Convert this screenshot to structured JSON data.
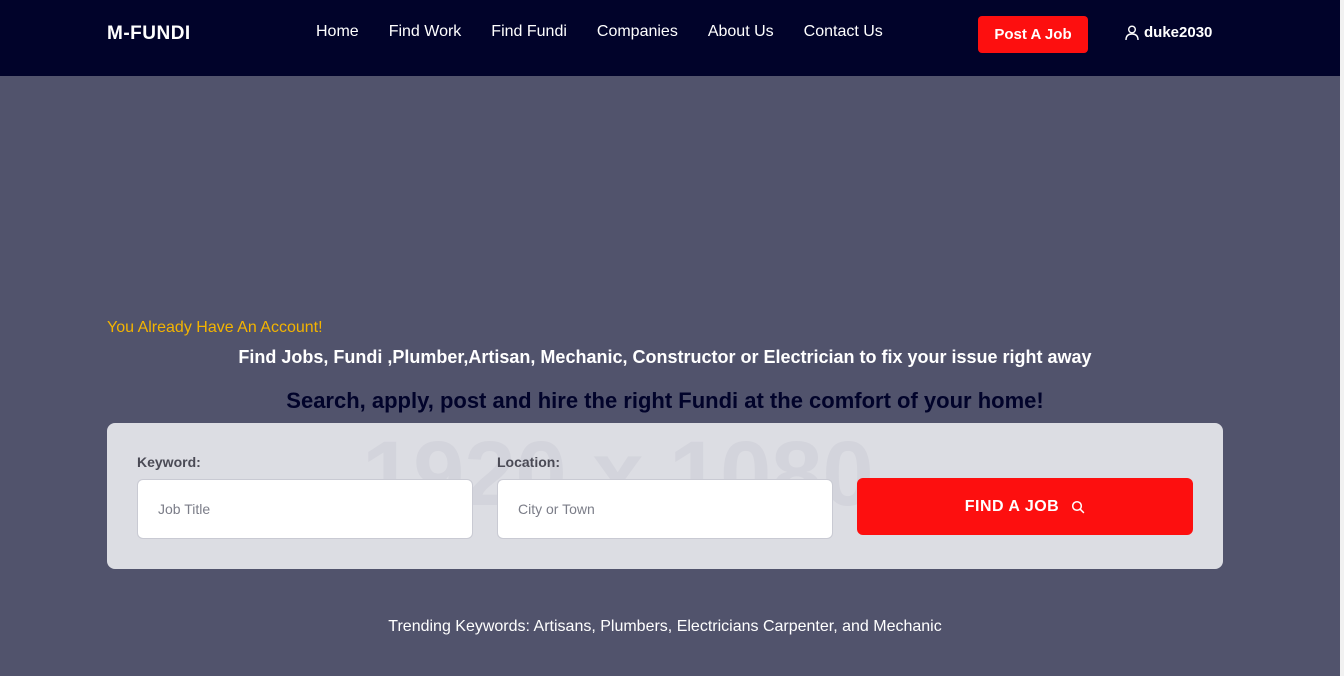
{
  "header": {
    "brand": "M-FUNDI",
    "nav": [
      {
        "label": "Home"
      },
      {
        "label": "Find Work"
      },
      {
        "label": "Find Fundi"
      },
      {
        "label": "Companies"
      },
      {
        "label": "About Us"
      },
      {
        "label": "Contact Us"
      }
    ],
    "post_job_label": "Post A Job",
    "user": {
      "icon": "user-icon",
      "name": "duke2030"
    }
  },
  "hero": {
    "account_text": "You Already Have An Account!",
    "tagline": "Find Jobs, Fundi ,Plumber,Artisan, Mechanic, Constructor or Electrician to fix your issue right away",
    "subheading": "Search, apply, post and hire the right Fundi at the comfort of your home!"
  },
  "search": {
    "watermark": "1920 x 1080",
    "keyword": {
      "label": "Keyword:",
      "placeholder": "Job Title",
      "value": ""
    },
    "location": {
      "label": "Location:",
      "placeholder": "City or Town",
      "value": ""
    },
    "button_label": "FIND A JOB",
    "button_icon": "search-icon"
  },
  "trending": "Trending Keywords: Artisans, Plumbers, Electricians Carpenter, and Mechanic",
  "colors": {
    "header_bg": "#01032a",
    "page_bg": "#51536c",
    "accent_red": "#fd0f0f",
    "account_link": "#f4b400",
    "panel_bg": "#dcdde3"
  }
}
